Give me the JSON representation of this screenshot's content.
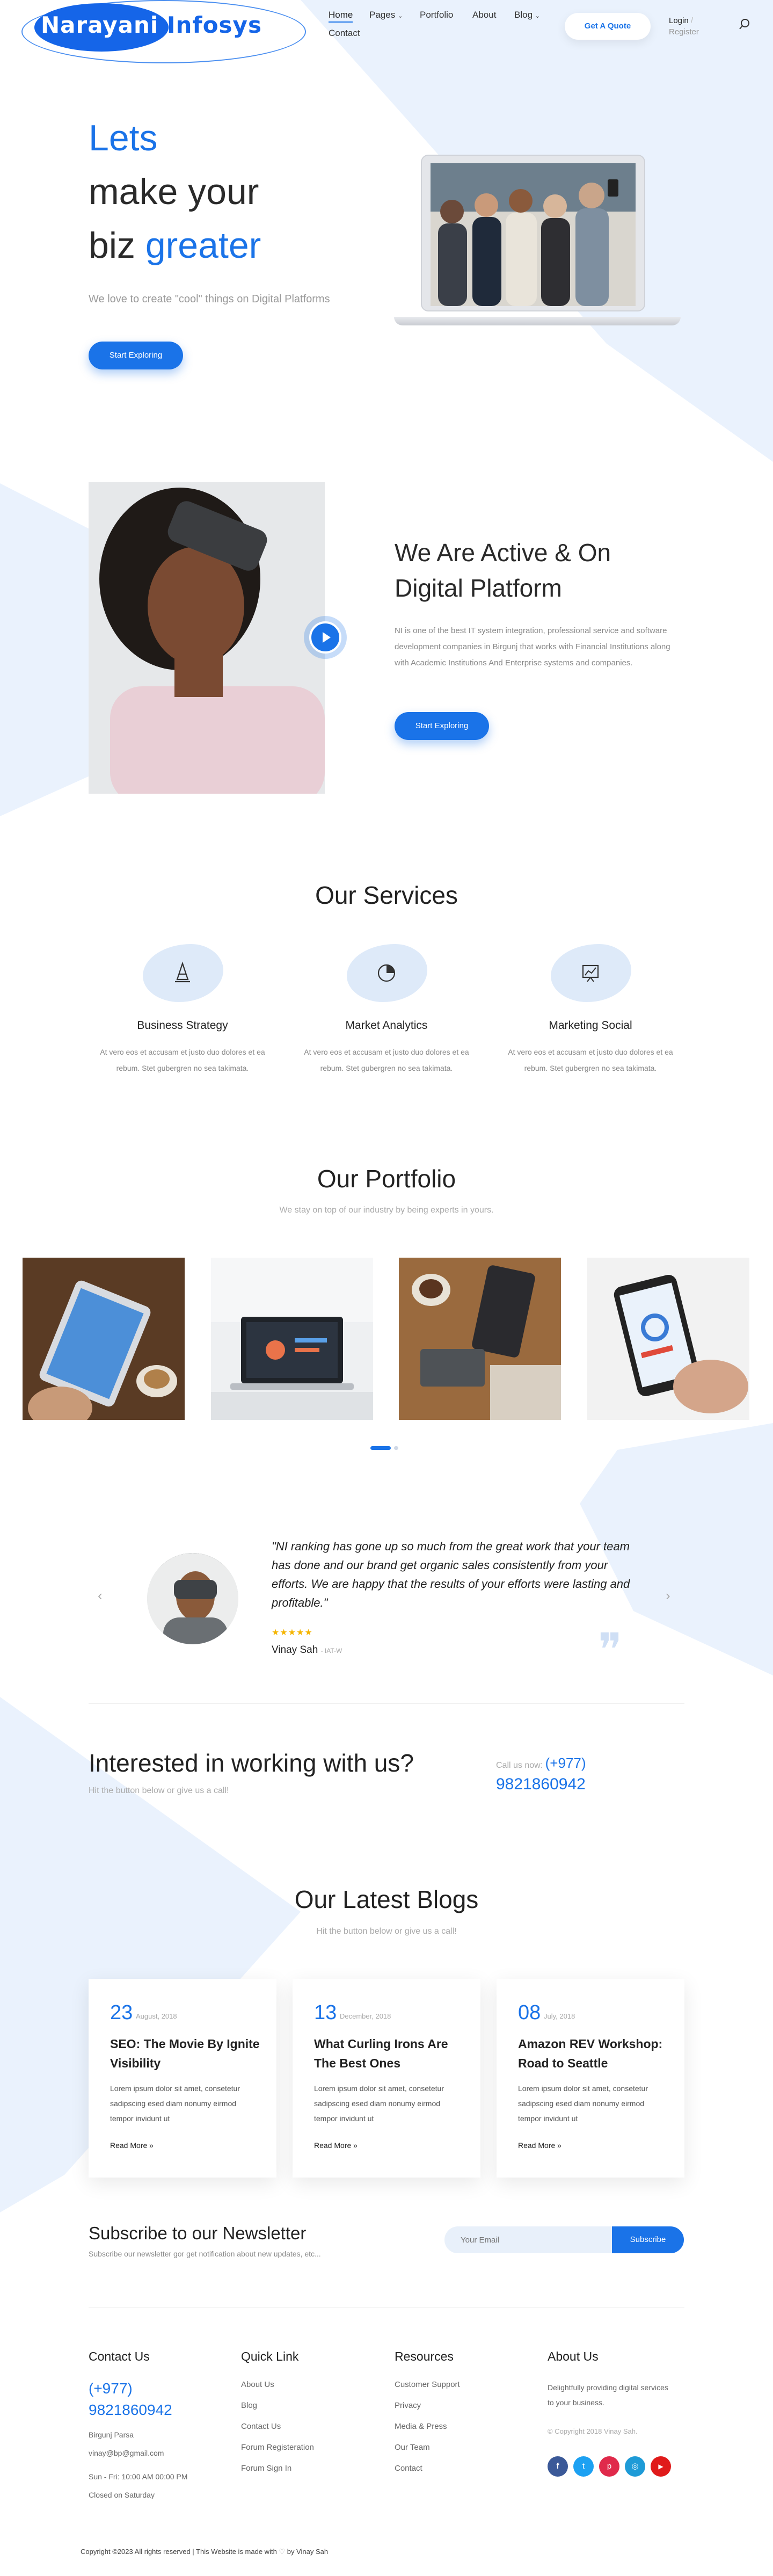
{
  "header": {
    "logo_word1": "Narayani",
    "logo_word2": "Infosys",
    "nav": [
      "Home",
      "Pages",
      "Portfolio",
      "About",
      "Blog",
      "Contact"
    ],
    "quote_label": "Get A Quote",
    "login_label": "Login",
    "register_label": "Register"
  },
  "hero": {
    "line1": "Lets",
    "line2": "make your",
    "line3_plain": "biz",
    "line3_blue": "greater",
    "subtitle": "We love to create \"cool\" things on Digital Platforms",
    "cta_label": "Start Exploring"
  },
  "about": {
    "title_line1": "We Are Active & On",
    "title_line2": "Digital Platform",
    "text": "NI is one of the best IT system integration, professional service and software development companies in Birgunj that works with Financial Institutions along with Academic Institutions And Enterprise systems and companies.",
    "cta_label": "Start Exploring"
  },
  "services": {
    "title": "Our Services",
    "items": [
      {
        "title": "Business Strategy",
        "text": "At vero eos et accusam et justo duo dolores et ea rebum. Stet gubergren no sea takimata."
      },
      {
        "title": "Market Analytics",
        "text": "At vero eos et accusam et justo duo dolores et ea rebum. Stet gubergren no sea takimata."
      },
      {
        "title": "Marketing Social",
        "text": "At vero eos et accusam et justo duo dolores et ea rebum. Stet gubergren no sea takimata."
      }
    ]
  },
  "portfolio": {
    "title": "Our Portfolio",
    "subtitle": "We stay on top of our industry by being experts in yours."
  },
  "testimonial": {
    "quote": "\"NI ranking has gone up so much from the great work that your team has done and our brand get organic sales consistently from your efforts. We are happy that the results of your efforts were lasting and profitable.\"",
    "stars": 5,
    "name": "Vinay Sah",
    "role": "- IAT-W"
  },
  "cta": {
    "title": "Interested in working with us?",
    "subtitle": "Hit the button below or give us a call!",
    "call_label": "Call us now:",
    "call_prefix": "(+977)",
    "call_number": "9821860942"
  },
  "blogs": {
    "title": "Our Latest Blogs",
    "subtitle": "Hit the button below or give us a call!",
    "items": [
      {
        "day": "23",
        "month": "August, 2018",
        "title": "SEO: The Movie By Ignite Visibility",
        "body": "Lorem ipsum dolor sit amet, consetetur sadipscing esed diam nonumy eirmod tempor invidunt ut",
        "more": "Read More »"
      },
      {
        "day": "13",
        "month": "December, 2018",
        "title": "What Curling Irons Are The Best Ones",
        "body": "Lorem ipsum dolor sit amet, consetetur sadipscing esed diam nonumy eirmod tempor invidunt ut",
        "more": "Read More »"
      },
      {
        "day": "08",
        "month": "July, 2018",
        "title": "Amazon REV Workshop: Road to Seattle",
        "body": "Lorem ipsum dolor sit amet, consetetur sadipscing esed diam nonumy eirmod tempor invidunt ut",
        "more": "Read More »"
      }
    ]
  },
  "newsletter": {
    "title": "Subscribe to our Newsletter",
    "subtitle": "Subscribe our newsletter gor get notification about new updates, etc...",
    "placeholder": "Your Email",
    "button": "Subscribe"
  },
  "footer": {
    "contact": {
      "title": "Contact Us",
      "phone_prefix": "(+977)",
      "phone": "9821860942",
      "address": "Birgunj Parsa",
      "email": "vinay@bp@gmail.com",
      "hours": "Sun - Fri: 10:00 AM 00:00 PM",
      "closed": "Closed on Saturday"
    },
    "quick": {
      "title": "Quick Link",
      "links": [
        "About Us",
        "Blog",
        "Contact Us",
        "Forum Registeration",
        "Forum Sign In"
      ]
    },
    "resources": {
      "title": "Resources",
      "links": [
        "Customer Support",
        "Privacy",
        "Media & Press",
        "Our Team",
        "Contact"
      ]
    },
    "about": {
      "title": "About Us",
      "text": "Delightfully providing digital services to your business.",
      "copyright": "© Copyright 2018 Vinay Sah."
    },
    "social_colors": [
      "#3b5998",
      "#1da1f2",
      "#e02a4b",
      "#1e9bd7",
      "#e01b1b"
    ],
    "social_icons": [
      "facebook-icon",
      "twitter-icon",
      "pinterest-icon",
      "instagram-icon",
      "youtube-icon"
    ],
    "bottom_text": "Copyright ©2023 All rights reserved | This Website is made with",
    "bottom_by": "by Vinay Sah"
  },
  "colors": {
    "accent": "#1a73e8",
    "light_bg": "#e8f1fc"
  }
}
